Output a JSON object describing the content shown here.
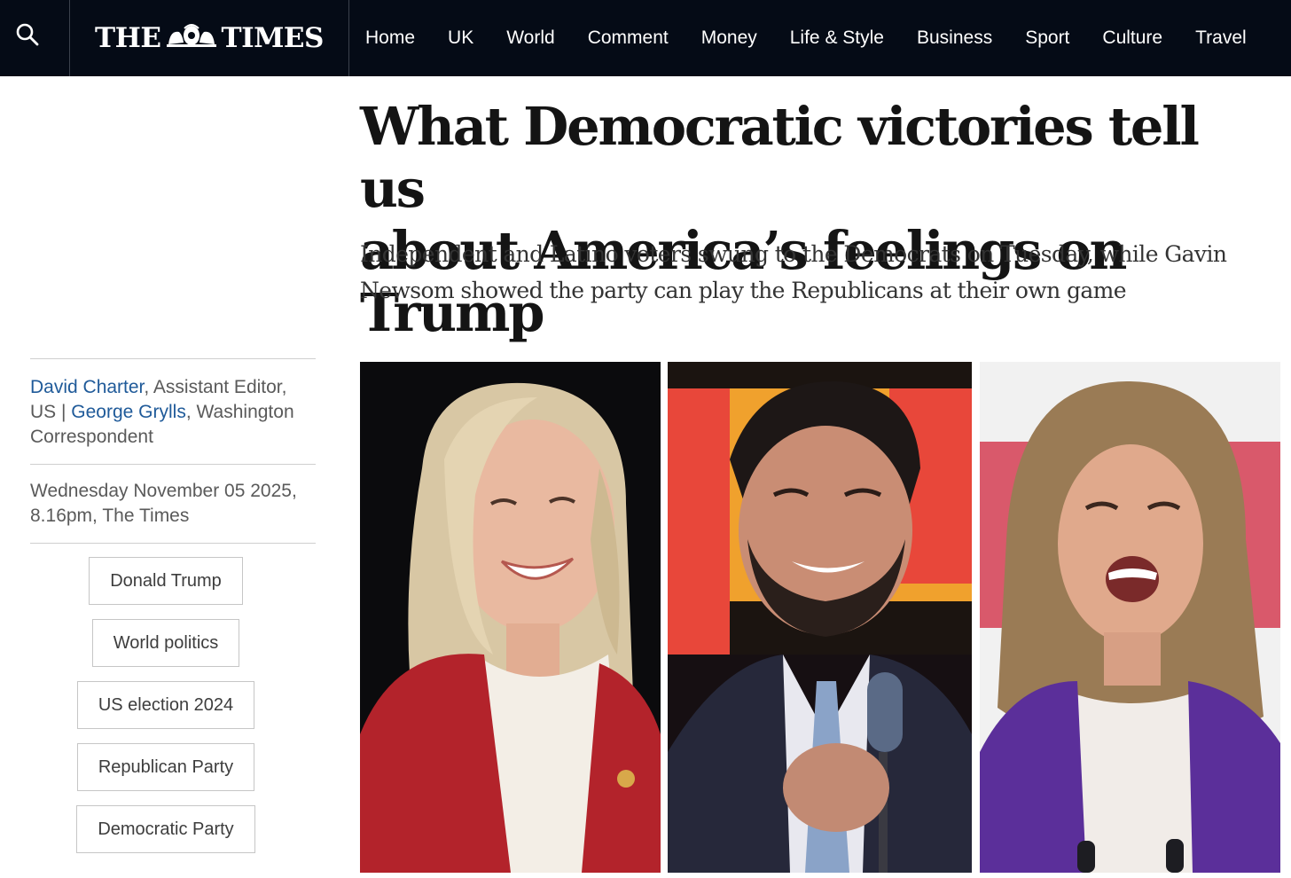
{
  "header": {
    "logo": {
      "left": "THE",
      "right": "TIMES"
    },
    "nav": [
      "Home",
      "UK",
      "World",
      "Comment",
      "Money",
      "Life & Style",
      "Business",
      "Sport",
      "Culture",
      "Travel"
    ]
  },
  "article": {
    "headline_line1": "What Democratic victories tell us",
    "headline_line2": "about America’s feelings on Trump",
    "standfirst_line1": "Independent and Latino voters swung to the Democrats on Tuesday, while Gavin",
    "standfirst_line2": "Newsom showed the party can play the Republicans at their own game"
  },
  "byline": {
    "author1": "David Charter",
    "role1_line1": ", Assistant Editor,",
    "role1_line2": "US | ",
    "author2": "George Grylls",
    "role2_line1": ", Washington",
    "role2_line2": "Correspondent"
  },
  "dateline": {
    "line1": "Wednesday November 05 2025,",
    "line2": "8.16pm, The Times"
  },
  "tags": [
    "Donald Trump",
    "World politics",
    "US election 2024",
    "Republican Party",
    "Democratic Party"
  ],
  "colors": {
    "nav_background": "#050b16",
    "author_link": "#1f5a99",
    "headline": "#141414"
  },
  "icons": {
    "search": "search-icon",
    "logo_crest": "royal-crest-icon"
  }
}
